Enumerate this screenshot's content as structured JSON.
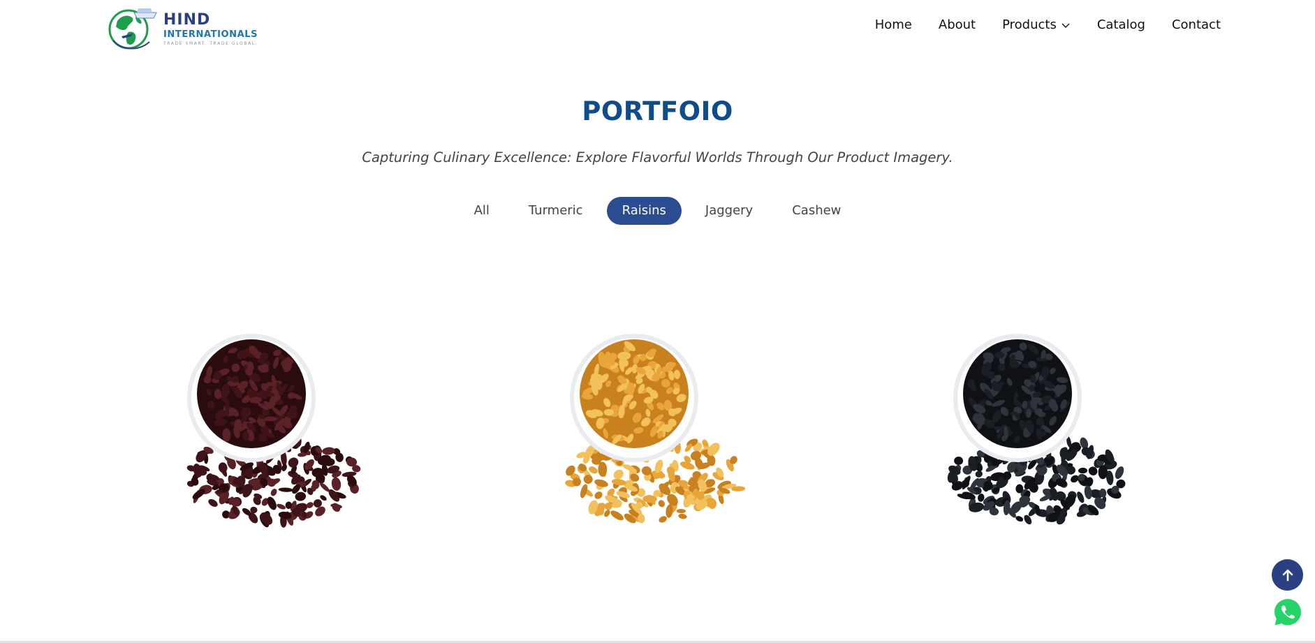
{
  "brand": {
    "name_line1": "HIND",
    "name_line2": "INTERNATIONALS",
    "tagline": "TRADE SMART. TRADE GLOBAL.",
    "colors": {
      "primary": "#2b3f83",
      "secondary": "#1d76b5",
      "globe_green": "#1e9e4a"
    }
  },
  "nav": {
    "items": [
      {
        "label": "Home"
      },
      {
        "label": "About"
      },
      {
        "label": "Products",
        "icon": "chevron-down-icon"
      },
      {
        "label": "Catalog"
      },
      {
        "label": "Contact"
      }
    ]
  },
  "portfolio": {
    "title": "PORTFOIO",
    "subtitle": "Capturing Culinary Excellence: Explore Flavorful Worlds Through Our Product Imagery.",
    "filters": [
      {
        "label": "All",
        "active": false
      },
      {
        "label": "Turmeric",
        "active": false
      },
      {
        "label": "Raisins",
        "active": true
      },
      {
        "label": "Jaggery",
        "active": false
      },
      {
        "label": "Cashew",
        "active": false
      }
    ],
    "active_color": "#2b4c90",
    "title_color": "#0e4d8a"
  },
  "products": [
    {
      "image": "brown-raisins-bowl-image",
      "colors": [
        "#3e1418",
        "#5a2226",
        "#2a0c0f"
      ]
    },
    {
      "image": "golden-raisins-bowl-image",
      "colors": [
        "#e9a53a",
        "#f2c15c",
        "#c9801f"
      ]
    },
    {
      "image": "black-raisins-bowl-image",
      "colors": [
        "#1b1e24",
        "#2e333c",
        "#0f1115"
      ]
    }
  ],
  "floating": {
    "back_to_top_icon": "arrow-up-icon",
    "whatsapp_icon": "whatsapp-icon",
    "whatsapp_color": "#25d366"
  }
}
